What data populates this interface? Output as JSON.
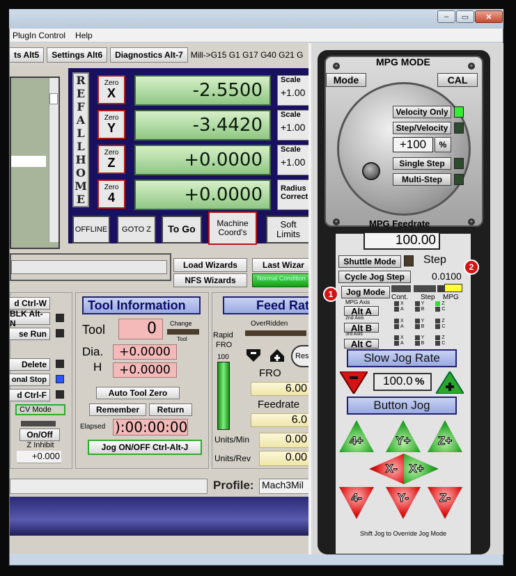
{
  "window": {
    "minimize": "–",
    "maximize": "▭",
    "close": "✕"
  },
  "menu": [
    "PlugIn Control",
    "Help"
  ],
  "toolbar": {
    "tab_alt5": "ts Alt5",
    "settings": "Settings Alt6",
    "diagnostics": "Diagnostics Alt-7",
    "gcodes": "Mill->G15  G1 G17 G40 G21 G"
  },
  "ref_home_letters": [
    "R",
    "E",
    "F",
    "A",
    "L",
    "L",
    "H",
    "O",
    "M",
    "E"
  ],
  "axes": [
    {
      "zero_small": "Zero",
      "zero_letter": "X",
      "value": "-2.5500",
      "scale_label": "Scale",
      "scale_val": "+1.00"
    },
    {
      "zero_small": "Zero",
      "zero_letter": "Y",
      "value": "-3.4420",
      "scale_label": "Scale",
      "scale_val": "+1.00"
    },
    {
      "zero_small": "Zero",
      "zero_letter": "Z",
      "value": "+0.0000",
      "scale_label": "Scale",
      "scale_val": "+1.00"
    },
    {
      "zero_small": "Zero",
      "zero_letter": "4",
      "value": "+0.0000",
      "scale_label": "Radius Correct",
      "scale_val": ""
    }
  ],
  "dro_buttons": {
    "offline": "OFFLINE",
    "gotoz": "GOTO Z",
    "togo": "To Go",
    "machine": "Machine Coord's",
    "soft": "Soft Limits"
  },
  "wizards": {
    "load": "Load Wizards",
    "last": "Last Wizar",
    "nfs": "NFS Wizards",
    "normal": "Normal Condition"
  },
  "left_controls": {
    "ctrlw": "d Ctrl-W",
    "blk": "BLK Alt-N",
    "rse": "se Run",
    "delete": "Delete",
    "optional": "onal Stop",
    "ctrlf": "d Ctrl-F",
    "cvmode": "CV Mode",
    "onoff": "On/Off",
    "zinhibit": "Z Inhibit",
    "zinhibit_val": "+0.000"
  },
  "tool": {
    "header": "Tool Information",
    "tool_label": "Tool",
    "tool_val": "0",
    "change": "Change",
    "change_sub": "Tool",
    "dia_label": "Dia.",
    "dia_val": "+0.0000",
    "h_label": "H",
    "h_val": "+0.0000",
    "auto_zero": "Auto Tool Zero",
    "remember": "Remember",
    "return": "Return",
    "elapsed_label": "Elapsed",
    "elapsed_val": "):00:00:00",
    "jog_onoff": "Jog ON/OFF Ctrl-Alt-J"
  },
  "feed": {
    "header": "Feed Rat",
    "overridden": "OverRidden",
    "rapid": "Rapid",
    "fro_small": "FRO",
    "pct": "100",
    "reset": "Res",
    "fro_label": "FRO",
    "fro_val": "6.00",
    "feedrate_label": "Feedrate",
    "feedrate_val": "6.0",
    "upm_label": "Units/Min",
    "upm_val": "0.00",
    "upr_label": "Units/Rev",
    "upr_val": "0.00"
  },
  "profile": {
    "label": "Profile:",
    "value": "Mach3Mil"
  },
  "mpg": {
    "title": "MPG MODE",
    "mode": "Mode",
    "cal": "CAL",
    "velocity_only": "Velocity Only",
    "step_velocity": "Step/Velocity",
    "pct_val": "+100",
    "pct_sign": "%",
    "single_step": "Single Step",
    "multi_step": "Multi-Step",
    "feedrate_label": "MPG Feedrate",
    "feedrate_val": "100.00",
    "shuttle": "Shuttle Mode",
    "step_label": "Step",
    "cycle_jog": "Cycle Jog Step",
    "cycle_val": "0.0100",
    "jog_mode": "Jog Mode",
    "cont": "Cont.",
    "step": "Step",
    "mpg": "MPG",
    "mpg_axis": "MPG Axis",
    "alt_a": "Alt A",
    "second_axis": "2nd Axis",
    "alt_b": "Alt B",
    "third_axis": "3rd Axis",
    "alt_c": "Alt C",
    "axis_letters": [
      [
        "X",
        "A",
        "Y",
        "B",
        "Z",
        "C"
      ],
      [
        "X",
        "A",
        "Y",
        "B",
        "Z",
        "C"
      ],
      [
        "X",
        "A",
        "Y",
        "B",
        "Z",
        "C"
      ]
    ],
    "slow_jog": "Slow Jog Rate",
    "minus": "-",
    "jog_val": "100.0",
    "jog_pct": "%",
    "plus": "+",
    "button_jog": "Button Jog",
    "jog": {
      "a4p": "4+",
      "yp": "Y+",
      "zp": "Z+",
      "xm": "X-",
      "xp": "X+",
      "a4m": "4-",
      "ym": "Y-",
      "zm": "Z-"
    },
    "shift_note": "Shift Jog to Override Jog Mode"
  },
  "badges": [
    "1",
    "2"
  ]
}
